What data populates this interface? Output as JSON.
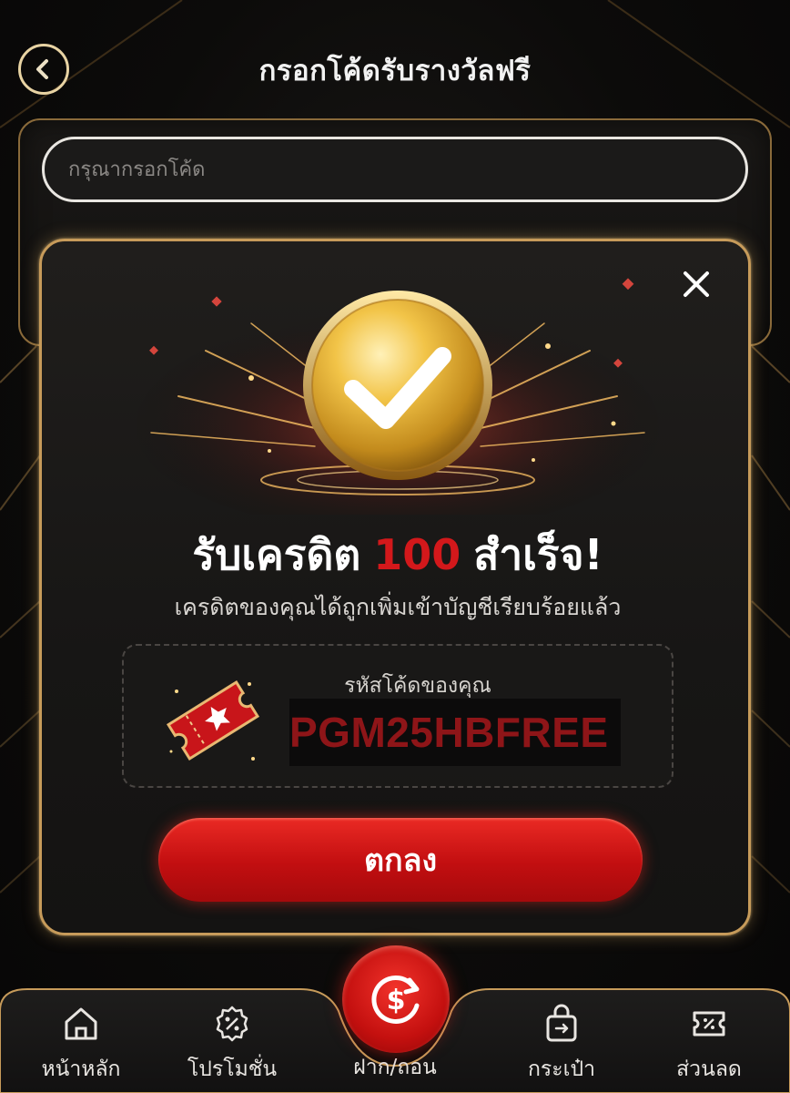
{
  "header": {
    "title": "กรอกโค้ดรับรางวัลฟรี",
    "back_icon": "chevron-left-icon"
  },
  "code_form": {
    "placeholder": "กรุณากรอกโค้ด",
    "value": ""
  },
  "modal": {
    "title_prefix": "รับเครดิต",
    "amount": "100",
    "title_suffix": "สำเร็จ!",
    "subtitle": "เครดิตของคุณได้ถูกเพิ่มเข้าบัญชีเรียบร้อยแล้ว",
    "code_label": "รหัสโค้ดของคุณ",
    "code_value": "PGM25HBFREE",
    "ok_label": "ตกลง",
    "close_icon": "close-icon",
    "badge_icon": "check-icon",
    "ticket_icon": "ticket-icon"
  },
  "bottom_nav": {
    "items": [
      {
        "label": "หน้าหลัก",
        "icon": "home-icon"
      },
      {
        "label": "โปรโมชั่น",
        "icon": "promotion-badge-icon"
      },
      {
        "label": "ฝาก/ถอน",
        "icon": "deposit-withdraw-icon"
      },
      {
        "label": "กระเป๋า",
        "icon": "wallet-bag-icon"
      },
      {
        "label": "ส่วนลด",
        "icon": "discount-coupon-icon"
      }
    ]
  },
  "colors": {
    "accent_red": "#d3181b",
    "gold": "#c79b5a",
    "background": "#0c0b0a"
  }
}
